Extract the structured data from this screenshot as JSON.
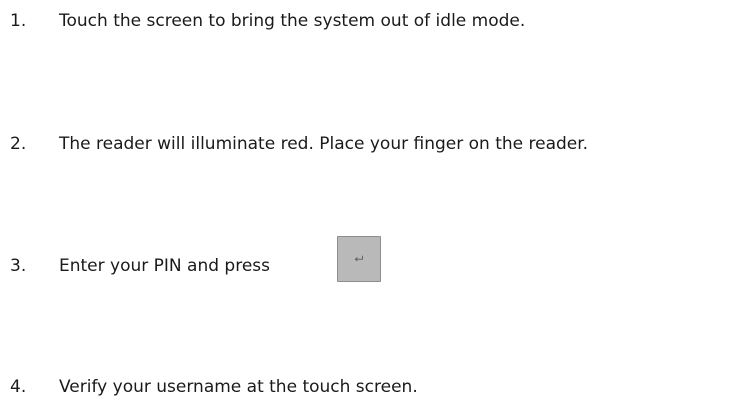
{
  "steps": [
    {
      "number": "1.",
      "text": "Touch the screen to bring the system out of idle mode."
    },
    {
      "number": "2.",
      "text": "The reader will illuminate red. Place your finger on the reader."
    },
    {
      "number": "3.",
      "text": "Enter your PIN and press"
    },
    {
      "number": "4.",
      "text": "Verify your username at the touch screen."
    }
  ],
  "enter_key": {
    "icon": "enter-return-icon",
    "color": "#b9b9b9"
  }
}
